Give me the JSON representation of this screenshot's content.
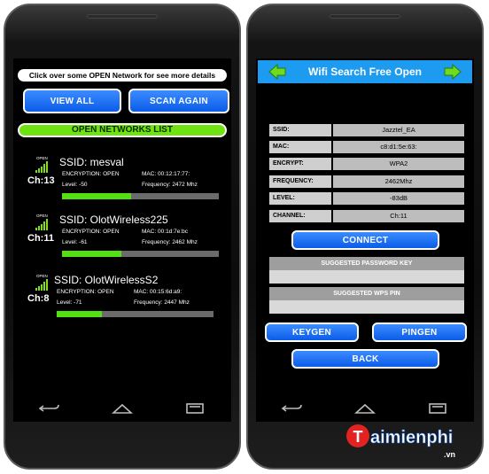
{
  "left_screen": {
    "notice": "Click over some OPEN Network for see more details",
    "view_all_label": "VIEW ALL",
    "scan_again_label": "SCAN AGAIN",
    "list_title": "OPEN NETWORKS LIST",
    "networks": [
      {
        "open_label": "OPEN",
        "channel": "Ch:13",
        "ssid": "SSID: mesval",
        "encryption": "ENCRYPTION: OPEN",
        "mac": "MAC: 00:12:17:77:",
        "level": "Level: -50",
        "frequency": "Frequency: 2472 Mhz",
        "signal_fraction": 0.44
      },
      {
        "open_label": "OPEN",
        "channel": "Ch:11",
        "ssid": "SSID: OlotWireless225",
        "encryption": "ENCRYPTION: OPEN",
        "mac": "MAC: 00:1d:7e:bc",
        "level": "Level: -61",
        "frequency": "Frequency: 2462 Mhz",
        "signal_fraction": 0.38
      },
      {
        "open_label": "OPEN",
        "channel": "Ch:8",
        "ssid": "SSID: OlotWirelessS2",
        "encryption": "ENCRYPTION: OPEN",
        "mac": "MAC: 00:15:6d:a9:",
        "level": "Level: -71",
        "frequency": "Frequency: 2447 Mhz",
        "signal_fraction": 0.29
      }
    ]
  },
  "right_screen": {
    "title": "Wifi Search Free Open",
    "fields": [
      {
        "key": "SSID:",
        "value": "Jazztel_EA"
      },
      {
        "key": "MAC:",
        "value": "c8:d1:5e:63:"
      },
      {
        "key": "ENCRYPT:",
        "value": "WPA2"
      },
      {
        "key": "FREQUENCY:",
        "value": "2462Mhz"
      },
      {
        "key": "LEVEL:",
        "value": "-83dB"
      },
      {
        "key": "CHANNEL:",
        "value": "Ch:11"
      }
    ],
    "connect_label": "CONNECT",
    "suggested_password_label": "SUGGESTED PASSWORD KEY",
    "suggested_wps_label": "SUGGESTED WPS PIN",
    "keygen_label": "KEYGEN",
    "pingen_label": "PINGEN",
    "back_label": "BACK"
  },
  "colors": {
    "button_blue": "#0b5ce8",
    "list_green": "#6fe310",
    "header_blue": "#1d9bf0",
    "arrow_green": "#6ddc1e"
  },
  "watermark": {
    "brand": "Taimienphi",
    "suffix": ".vn"
  }
}
